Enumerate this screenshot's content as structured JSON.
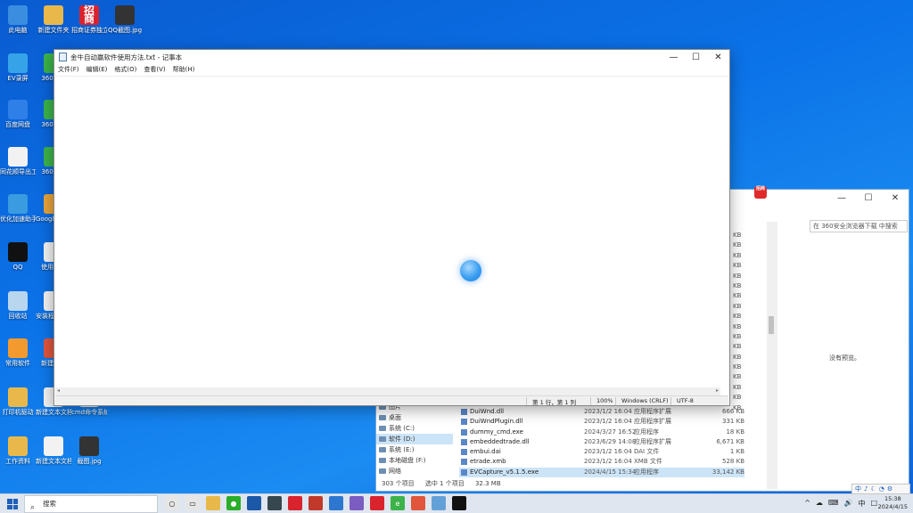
{
  "desktop_icons": [
    {
      "id": "pc",
      "label": "此电脑",
      "color": "#3b8de0"
    },
    {
      "id": "newfolder",
      "label": "新建文件夹",
      "color": "#e8b94a"
    },
    {
      "id": "zhaoshang",
      "label": "招商证券独立交易",
      "color": "#d9232d",
      "glyph": "招商"
    },
    {
      "id": "pic1",
      "label": "QQ截图.jpg",
      "color": "#333"
    },
    {
      "id": "evrec",
      "label": "EV录屏",
      "color": "#36a3e8"
    },
    {
      "id": "s360",
      "label": "360安全",
      "color": "#3bb34a"
    },
    {
      "id": "baiduyun",
      "label": "百度网盘",
      "color": "#2f7fe8"
    },
    {
      "id": "s360b",
      "label": "360杀毒",
      "color": "#3bb34a"
    },
    {
      "id": "doc1",
      "label": "同花顺导出工具使用说明.txt",
      "color": "#f2f2f2"
    },
    {
      "id": "s360c",
      "label": "360软件",
      "color": "#3bb34a"
    },
    {
      "id": "assistant",
      "label": "优化加速助手",
      "color": "#3a9be0"
    },
    {
      "id": "chrome",
      "label": "Google Chrome",
      "color": "#e9a33b"
    },
    {
      "id": "qq",
      "label": "QQ",
      "color": "#111"
    },
    {
      "id": "doc2",
      "label": "使用说明",
      "color": "#f2f2f2"
    },
    {
      "id": "recycle",
      "label": "回收站",
      "color": "#b9d6ef"
    },
    {
      "id": "setup",
      "label": "安装程序_v2.0",
      "color": "#f2f2f2"
    },
    {
      "id": "mahjong",
      "label": "常用软件",
      "color": "#f29a2e"
    },
    {
      "id": "app7",
      "label": "新建文件",
      "color": "#e0553b"
    },
    {
      "id": "folder2",
      "label": "打印机驱动",
      "color": "#e8b94a"
    },
    {
      "id": "doc3",
      "label": "新建文本文档.txt",
      "color": "#f2f2f2"
    },
    {
      "id": "doc4",
      "label": "cmd命令系统使用说明",
      "color": "#f2f2f2"
    },
    {
      "id": "folder3",
      "label": "工作资料",
      "color": "#e8b94a"
    },
    {
      "id": "doc5",
      "label": "新建文本文档.txt",
      "color": "#f2f2f2"
    },
    {
      "id": "pic2",
      "label": "截图.jpg",
      "color": "#333"
    }
  ],
  "notepad": {
    "title": "金牛自动赢软件使用方法.txt - 记事本",
    "menu": [
      "文件(F)",
      "编辑(E)",
      "格式(O)",
      "查看(V)",
      "帮助(H)"
    ],
    "status": {
      "position": "第 1 行，第 1 列",
      "zoom": "100%",
      "eol": "Windows (CRLF)",
      "encoding": "UTF-8"
    },
    "content": ""
  },
  "explorer": {
    "search_placeholder": "在 360安全浏览器下载 中搜索",
    "preview_text": "没有预览。",
    "nav_items": [
      {
        "label": "图片",
        "selected": false
      },
      {
        "label": "桌面",
        "selected": false
      },
      {
        "label": "系统 (C:)",
        "selected": false
      },
      {
        "label": "软件 (D:)",
        "selected": true
      },
      {
        "label": "系统 (E:)",
        "selected": false
      },
      {
        "label": "本地磁盘 (F:)",
        "selected": false
      },
      {
        "label": "网络",
        "selected": false
      }
    ],
    "files": [
      {
        "name": "DuiWnd.dll",
        "date": "2023/1/2 16:04",
        "type": "应用程序扩展",
        "size": "666 KB"
      },
      {
        "name": "DuiWndPlugin.dll",
        "date": "2023/1/2 16:04",
        "type": "应用程序扩展",
        "size": "331 KB"
      },
      {
        "name": "dummy_cmd.exe",
        "date": "2024/3/27 16:52",
        "type": "应用程序",
        "size": "18 KB"
      },
      {
        "name": "embeddedtrade.dll",
        "date": "2023/6/29 14:08",
        "type": "应用程序扩展",
        "size": "6,671 KB"
      },
      {
        "name": "embui.dai",
        "date": "2023/1/2 16:04",
        "type": "DAI 文件",
        "size": "1 KB"
      },
      {
        "name": "etrade.xmb",
        "date": "2023/1/2 16:04",
        "type": "XMB 文件",
        "size": "528 KB"
      },
      {
        "name": "EVCapture_v5.1.5.exe",
        "date": "2024/4/15 15:34",
        "type": "应用程序",
        "size": "33,142 KB",
        "selected": true
      }
    ],
    "kb_column": [
      "KB",
      "KB",
      "KB",
      "KB",
      "KB",
      "KB",
      "KB",
      "KB",
      "KB",
      "KB",
      "KB",
      "KB",
      "KB",
      "KB",
      "KB",
      "KB",
      "KB",
      "KB"
    ],
    "status": {
      "items": "303 个项目",
      "selected": "选中 1 个项目",
      "size": "32.3 MB"
    }
  },
  "taskbar": {
    "search_placeholder": "搜索",
    "apps": [
      {
        "id": "cortana",
        "color": "#e6e6e6",
        "glyph": "○"
      },
      {
        "id": "taskview",
        "color": "#e6e6e6",
        "glyph": "▭"
      },
      {
        "id": "explorer",
        "color": "#e8b94a",
        "glyph": ""
      },
      {
        "id": "wechat",
        "color": "#2aae2a",
        "glyph": "●"
      },
      {
        "id": "media",
        "color": "#1c58a8",
        "glyph": ""
      },
      {
        "id": "calc",
        "color": "#37474f",
        "glyph": ""
      },
      {
        "id": "shield",
        "color": "#d9232d",
        "glyph": ""
      },
      {
        "id": "game",
        "color": "#c0392b",
        "glyph": ""
      },
      {
        "id": "notes",
        "color": "#2d77d0",
        "glyph": ""
      },
      {
        "id": "ide",
        "color": "#7b5cc0",
        "glyph": ""
      },
      {
        "id": "zs",
        "color": "#d9232d",
        "glyph": ""
      },
      {
        "id": "s360",
        "color": "#3bb34a",
        "glyph": "e"
      },
      {
        "id": "tool",
        "color": "#e0553b",
        "glyph": ""
      },
      {
        "id": "notepad",
        "color": "#64a0d8",
        "glyph": ""
      },
      {
        "id": "qq",
        "color": "#111",
        "glyph": ""
      }
    ],
    "tray": [
      "^",
      "☁",
      "⌨",
      "🔊",
      "中",
      "□"
    ],
    "time": "15:38",
    "date": "2024/4/15"
  },
  "ime": {
    "items": [
      "中",
      "♪",
      "☾",
      "◔",
      "⚙"
    ]
  },
  "badge_label": "招商"
}
